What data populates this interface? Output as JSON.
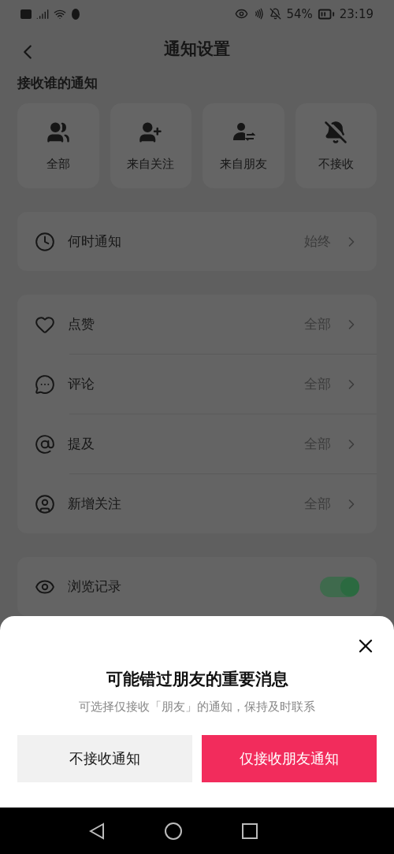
{
  "status_bar": {
    "battery": "54%",
    "time": "23:19"
  },
  "header": {
    "title": "通知设置"
  },
  "audience": {
    "title": "接收谁的通知",
    "options": [
      {
        "kind": "all",
        "label": "全部"
      },
      {
        "kind": "following",
        "label": "来自关注"
      },
      {
        "kind": "friends",
        "label": "来自朋友"
      },
      {
        "kind": "none",
        "label": "不接收"
      }
    ]
  },
  "timing": [
    {
      "kind": "clock",
      "label": "何时通知",
      "value": "始终"
    }
  ],
  "interactions": [
    {
      "kind": "like",
      "label": "点赞",
      "value": "全部"
    },
    {
      "kind": "comment",
      "label": "评论",
      "value": "全部"
    },
    {
      "kind": "mention",
      "label": "提及",
      "value": "全部"
    },
    {
      "kind": "follower",
      "label": "新增关注",
      "value": "全部"
    }
  ],
  "privacy": [
    {
      "kind": "eye",
      "label": "浏览记录",
      "on": true
    }
  ],
  "sheet": {
    "title": "可能错过朋友的重要消息",
    "subtitle": "可选择仅接收「朋友」的通知，保持及时联系",
    "buttons": [
      {
        "kind": "secondary",
        "label": "不接收通知"
      },
      {
        "kind": "primary",
        "label": "仅接收朋友通知"
      }
    ]
  }
}
